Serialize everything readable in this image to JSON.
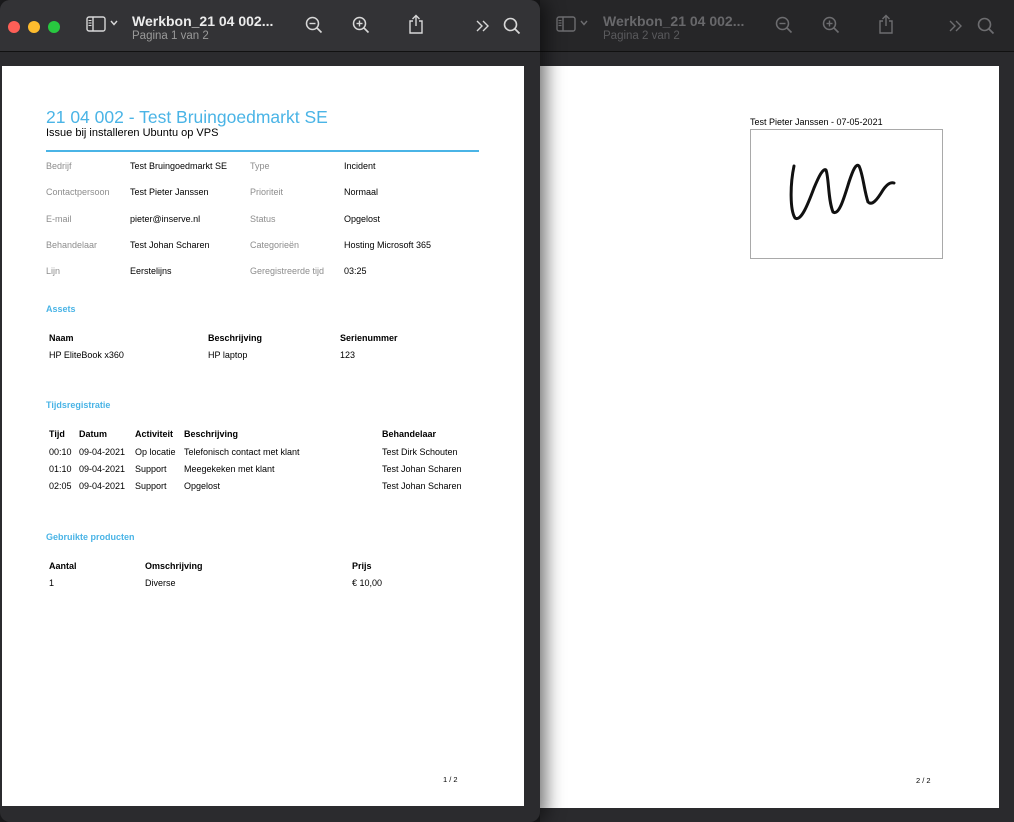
{
  "front_window": {
    "title": "Werkbon_21 04 002...",
    "subtitle": "Pagina 1 van 2"
  },
  "back_window": {
    "title": "Werkbon_21 04 002...",
    "subtitle": "Pagina 2 van 2"
  },
  "toolbar_icons": [
    "sidebar-icon",
    "chevron-down-icon",
    "zoom-out-icon",
    "zoom-in-icon",
    "share-icon",
    "more-icon",
    "search-icon"
  ],
  "page1": {
    "title": "21 04 002 - Test Bruingoedmarkt SE",
    "subtitle": "Issue bij installeren Ubuntu op VPS",
    "accent_color": "#4ab4e6",
    "info": [
      {
        "label": "Bedrijf",
        "value": "Test Bruingoedmarkt SE",
        "label2": "Type",
        "value2": "Incident"
      },
      {
        "label": "Contactpersoon",
        "value": "Test Pieter Janssen",
        "label2": "Prioriteit",
        "value2": "Normaal"
      },
      {
        "label": "E-mail",
        "value": "pieter@inserve.nl",
        "label2": "Status",
        "value2": "Opgelost"
      },
      {
        "label": "Behandelaar",
        "value": "Test Johan Scharen",
        "label2": "Categorieën",
        "value2": "Hosting Microsoft 365"
      },
      {
        "label": "Lijn",
        "value": "Eerstelijns",
        "label2": "Geregistreerde tijd",
        "value2": "03:25"
      }
    ],
    "assets": {
      "heading": "Assets",
      "headers": [
        "Naam",
        "Beschrijving",
        "Serienummer"
      ],
      "rows": [
        [
          "HP EliteBook x360",
          "HP laptop",
          "123"
        ]
      ]
    },
    "time": {
      "heading": "Tijdsregistratie",
      "headers": [
        "Tijd",
        "Datum",
        "Activiteit",
        "Beschrijving",
        "Behandelaar"
      ],
      "rows": [
        [
          "00:10",
          "09-04-2021",
          "Op locatie",
          "Telefonisch contact met klant",
          "Test Dirk Schouten"
        ],
        [
          "01:10",
          "09-04-2021",
          "Support",
          "Meegekeken met klant",
          "Test Johan Scharen"
        ],
        [
          "02:05",
          "09-04-2021",
          "Support",
          "Opgelost",
          "Test Johan Scharen"
        ]
      ]
    },
    "products": {
      "heading": "Gebruikte producten",
      "headers": [
        "Aantal",
        "Omschrijving",
        "Prijs"
      ],
      "rows": [
        [
          "1",
          "Diverse",
          "€ 10,00"
        ]
      ]
    },
    "page_number": "1 / 2"
  },
  "page2": {
    "signature_caption": "Test Pieter Janssen - 07-05-2021",
    "page_number": "2 / 2"
  }
}
